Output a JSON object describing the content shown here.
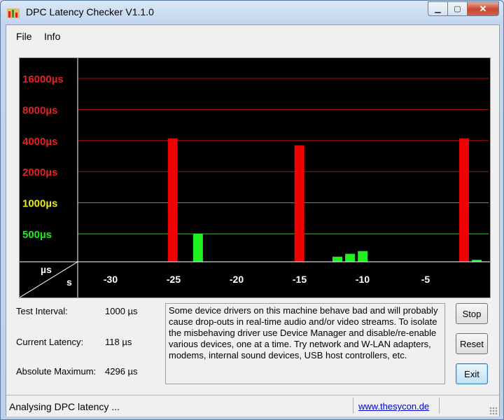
{
  "window": {
    "title": "DPC Latency Checker V1.1.0"
  },
  "menu": {
    "items": [
      "File",
      "Info"
    ]
  },
  "chart_data": {
    "type": "bar",
    "y_scale": "log",
    "y_ticks": [
      {
        "label": "16000µs",
        "value": 16000,
        "color": "#e82020"
      },
      {
        "label": "8000µs",
        "value": 8000,
        "color": "#e82020"
      },
      {
        "label": "4000µs",
        "value": 4000,
        "color": "#e82020"
      },
      {
        "label": "2000µs",
        "value": 2000,
        "color": "#e82020"
      },
      {
        "label": "1000µs",
        "value": 1000,
        "color": "#e8e820"
      },
      {
        "label": "500µs",
        "value": 500,
        "color": "#20e820"
      }
    ],
    "x_ticks": [
      "-30",
      "-25",
      "-20",
      "-15",
      "-10",
      "-5"
    ],
    "x_tick_values": [
      -30,
      -25,
      -20,
      -15,
      -10,
      -5
    ],
    "corner_labels": {
      "y_unit": "µs",
      "x_unit": "s"
    },
    "x": [
      -32,
      -31,
      -30,
      -29,
      -28,
      -27,
      -26,
      -25,
      -24,
      -23,
      -22,
      -21,
      -20,
      -19,
      -18,
      -17,
      -16,
      -15,
      -14,
      -13,
      -12,
      -11,
      -10,
      -9,
      -8,
      -7,
      -6,
      -5,
      -4,
      -3,
      -2,
      -1
    ],
    "values": [
      120,
      120,
      120,
      115,
      115,
      115,
      130,
      4200,
      150,
      500,
      150,
      130,
      115,
      120,
      120,
      115,
      120,
      3600,
      120,
      230,
      300,
      320,
      340,
      120,
      190,
      180,
      120,
      120,
      120,
      120,
      4200,
      280,
      120
    ],
    "red_threshold": 2000,
    "colors": {
      "ok": "#20f020",
      "bad": "#f00000",
      "red_grid": "#b01010",
      "green_grid": "#30c030",
      "axis": "#ffffff"
    }
  },
  "stats": {
    "interval_label": "Test Interval:",
    "interval_value": "1000 µs",
    "current_label": "Current Latency:",
    "current_value": "118 µs",
    "max_label": "Absolute Maximum:",
    "max_value": "4296 µs"
  },
  "message": "Some device drivers on this machine behave bad and will probably cause drop-outs in real-time audio and/or video streams. To isolate the misbehaving driver use Device Manager and disable/re-enable various devices, one at a time. Try network and W-LAN adapters, modems, internal sound devices, USB host controllers, etc.",
  "buttons": {
    "stop": "Stop",
    "reset": "Reset",
    "exit": "Exit"
  },
  "status": {
    "text": "Analysing DPC latency ...",
    "link": "www.thesycon.de"
  }
}
